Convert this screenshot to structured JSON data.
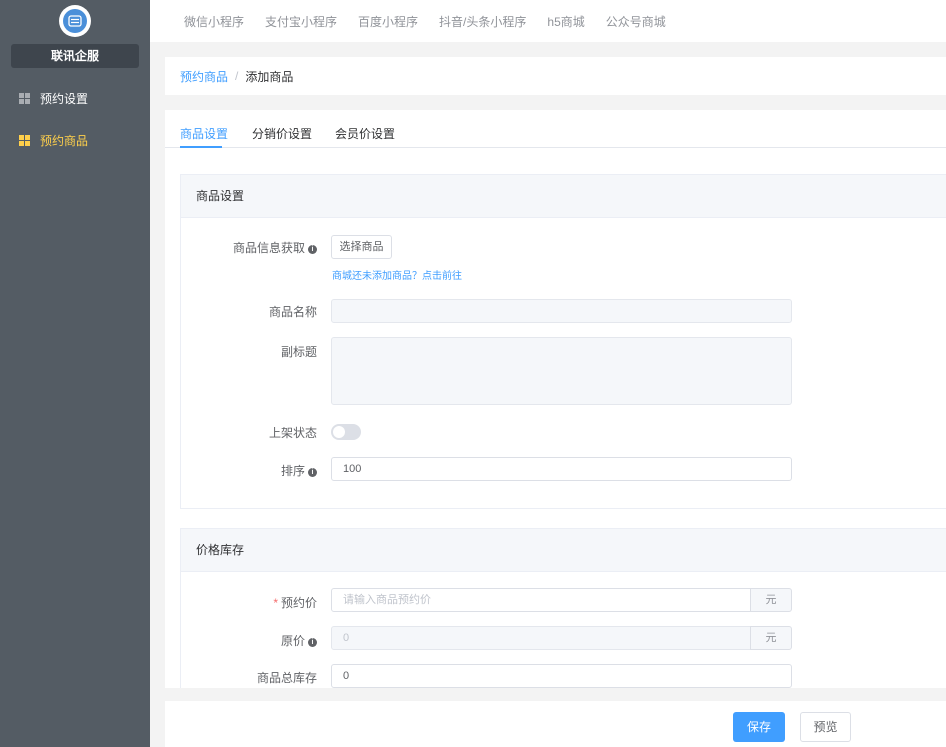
{
  "sidebar": {
    "brand": "联讯企服",
    "items": [
      {
        "label": "预约设置",
        "active": false
      },
      {
        "label": "预约商品",
        "active": true
      }
    ]
  },
  "topnav": {
    "items": [
      "微信小程序",
      "支付宝小程序",
      "百度小程序",
      "抖音/头条小程序",
      "h5商城",
      "公众号商城"
    ]
  },
  "breadcrumb": {
    "parent": "预约商品",
    "separator": "/",
    "current": "添加商品"
  },
  "tabs": [
    "商品设置",
    "分销价设置",
    "会员价设置"
  ],
  "product_section": {
    "title": "商品设置",
    "fetch_label": "商品信息获取",
    "select_button": "选择商品",
    "hint_link": "商城还未添加商品？点击前往",
    "name_label": "商品名称",
    "name_value": "",
    "subtitle_label": "副标题",
    "subtitle_value": "",
    "status_label": "上架状态",
    "status_on": false,
    "sort_label": "排序",
    "sort_value": "100"
  },
  "price_section": {
    "title": "价格库存",
    "price_label": "预约价",
    "price_required": "*",
    "price_placeholder": "请输入商品预约价",
    "price_unit": "元",
    "original_label": "原价",
    "original_value": "0",
    "original_unit": "元",
    "stock_label": "商品总库存",
    "stock_value": "0"
  },
  "footer": {
    "save": "保存",
    "preview": "预览"
  },
  "colors": {
    "sidebar_bg": "#545c64",
    "active_menu": "#ffd04b",
    "primary": "#409eff"
  }
}
